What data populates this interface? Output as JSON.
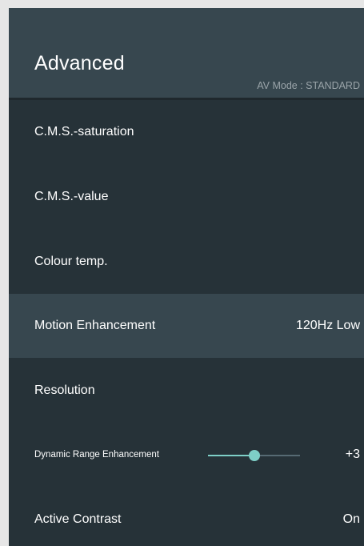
{
  "header": {
    "title": "Advanced",
    "av_mode": "AV Mode : STANDARD"
  },
  "menu": {
    "items": [
      {
        "label": "C.M.S.-saturation",
        "value": ""
      },
      {
        "label": "C.M.S.-value",
        "value": ""
      },
      {
        "label": "Colour temp.",
        "value": ""
      },
      {
        "label": "Motion Enhancement",
        "value": "120Hz Low",
        "selected": true
      },
      {
        "label": "Resolution",
        "value": ""
      },
      {
        "label": "Dynamic Range Enhancement",
        "value": "+3",
        "slider_level": 0.5
      },
      {
        "label": "Active Contrast",
        "value": "On"
      }
    ]
  },
  "colors": {
    "panel_background": "#263238",
    "header_background": "#37474f",
    "selected_row": "#37474f",
    "slider_accent": "#7ecfc7",
    "text": "#ffffff",
    "secondary_text": "#9aa4a9"
  }
}
